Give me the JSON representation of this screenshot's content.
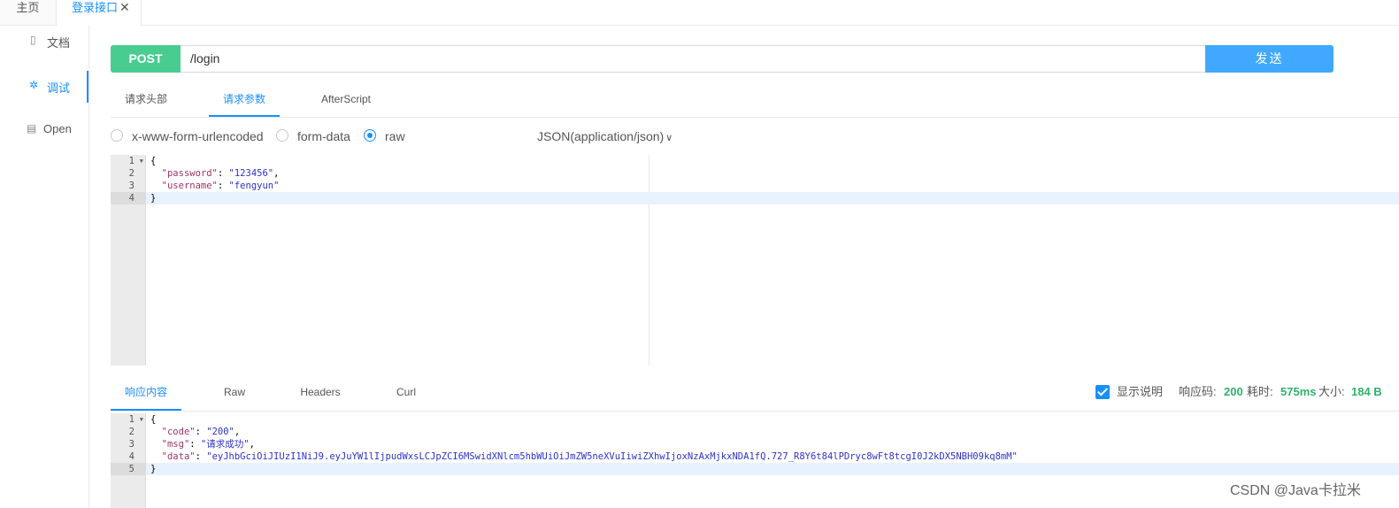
{
  "tabs": {
    "home": "主页",
    "active": "登录接口",
    "close": "✕"
  },
  "nav": [
    {
      "label": "文档",
      "icon": "doc-icon",
      "glyph": "▯"
    },
    {
      "label": "调试",
      "icon": "bug-icon",
      "glyph": "✲"
    },
    {
      "label": "Open",
      "icon": "file-icon",
      "glyph": "▤"
    }
  ],
  "request": {
    "method": "POST",
    "url": "/login",
    "send": "发送"
  },
  "subtabs": [
    "请求头部",
    "请求参数",
    "AfterScript"
  ],
  "body_types": {
    "urlencoded": "x-www-form-urlencoded",
    "formdata": "form-data",
    "raw": "raw",
    "content_type": "JSON(application/json)"
  },
  "request_body": {
    "line_numbers": [
      "1",
      "2",
      "3",
      "4"
    ],
    "lines": [
      "{",
      "  \"password\": \"123456\",",
      "  \"username\": \"fengyun\"",
      "}"
    ]
  },
  "response_tabs": [
    "响应内容",
    "Raw",
    "Headers",
    "Curl"
  ],
  "response_meta": {
    "show_desc": "显示说明",
    "code_label": "响应码:",
    "code": "200",
    "time_label": "耗时:",
    "time": "575ms",
    "size_label": "大小:",
    "size": "184 B"
  },
  "response_body": {
    "line_numbers": [
      "1",
      "2",
      "3",
      "4",
      "5"
    ],
    "lines": [
      "{",
      "  \"code\": \"200\",",
      "  \"msg\": \"请求成功\",",
      "  \"data\": \"eyJhbGciOiJIUzI1NiJ9.eyJuYW1lIjpudWxsLCJpZCI6MSwidXNlcm5hbWUiOiJmZW5neXVuIiwiZXhwIjoxNzAxMjkxNDA1fQ.727_R8Y6t84lPDryc8wFt8tcgI0J2kDX5NBH09kq8mM\"",
      "}"
    ]
  },
  "watermark": "CSDN @Java卡拉米"
}
